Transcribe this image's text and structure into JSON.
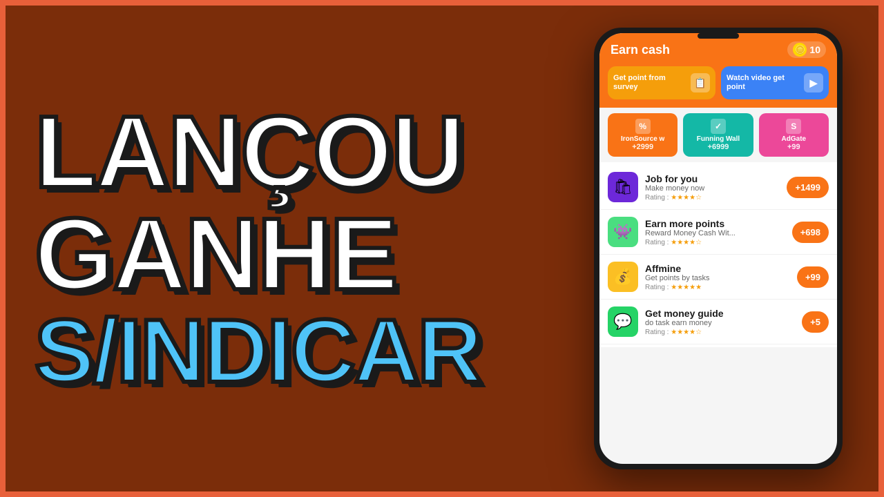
{
  "background": {
    "color": "#7B2D0A",
    "border_color": "#e8603a"
  },
  "left_text": {
    "line1": "LANÇOU",
    "line2": "GANHE",
    "line3": "S/INDICAR"
  },
  "app": {
    "title": "Earn cash",
    "coin_count": "10",
    "buttons": [
      {
        "label": "Get point from survey",
        "color": "yellow",
        "icon": "📋"
      },
      {
        "label": "Watch video get point",
        "color": "blue",
        "icon": "▶"
      }
    ],
    "providers": [
      {
        "name": "IronSource w",
        "points": "+2999",
        "color": "orange",
        "icon": "%"
      },
      {
        "name": "Funning Wall",
        "points": "+6999",
        "color": "teal",
        "icon": "✓"
      },
      {
        "name": "AdGate",
        "points": "+99",
        "color": "pink",
        "icon": "S"
      }
    ],
    "items": [
      {
        "name": "Job for you",
        "description": "Make money now",
        "rating": "4",
        "points": "+1499",
        "icon": "🛍",
        "icon_bg": "purple"
      },
      {
        "name": "Earn more points",
        "description": "Reward Money Cash Wit...",
        "rating": "4",
        "points": "+698",
        "icon": "👾",
        "icon_bg": "green-light"
      },
      {
        "name": "Affmine",
        "description": "Get points by tasks",
        "rating": "5",
        "points": "+99",
        "icon": "💰",
        "icon_bg": "yellow-gold"
      },
      {
        "name": "Get money guide",
        "description": "do task earn money",
        "rating": "4",
        "points": "+5",
        "icon": "💬",
        "icon_bg": "whatsapp"
      }
    ]
  }
}
